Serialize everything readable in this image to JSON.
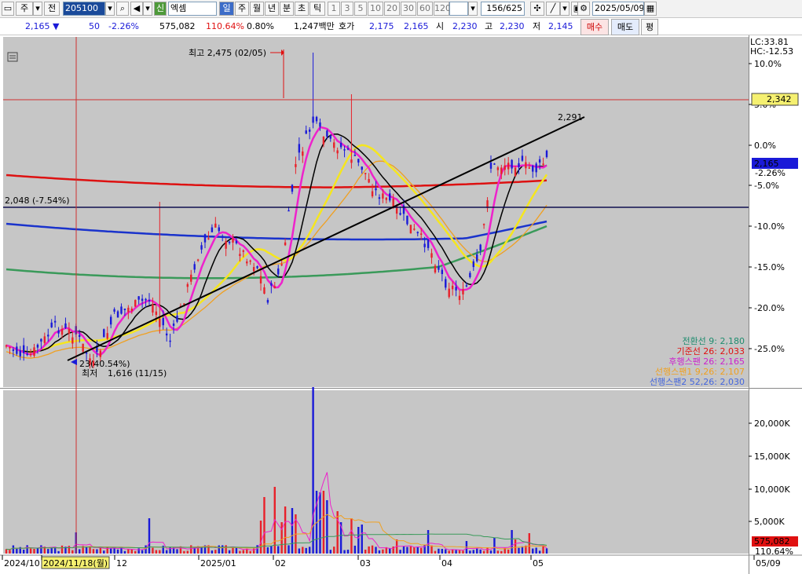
{
  "toolbar": {
    "mode_day": "주",
    "prev_label": "전",
    "code": "205100",
    "badge": "신",
    "stock_name": "엑셈",
    "periods": [
      "일",
      "주",
      "월",
      "년",
      "분",
      "초",
      "틱"
    ],
    "intervals": [
      "1",
      "3",
      "5",
      "10",
      "20",
      "30",
      "60",
      "120"
    ],
    "count": "156/625",
    "date": "2025/05/09"
  },
  "quote": {
    "price": "2,165",
    "arrow": "▼",
    "change": "50",
    "change_pct": "-2.26%",
    "volume": "575,082",
    "vol_ratio": "110.64%",
    "turnover": "0.80%",
    "amount": "1,247백만",
    "bid_label": "호가",
    "ask": "2,175",
    "bid": "2,165",
    "open_label": "시",
    "open": "2,230",
    "high_label": "고",
    "high": "2,230",
    "low_label": "저",
    "low": "2,145",
    "buy_button": "매수",
    "sell_button": "매도",
    "eval_button": "평"
  },
  "chart_data": {
    "type": "candlestick",
    "price_axis_ticks": [
      "10.0%",
      "5.0%",
      "0.0%",
      "-5.0%",
      "-10.0%",
      "-15.0%",
      "-20.0%",
      "-25.0%"
    ],
    "volume_axis_ticks": [
      "20,000K",
      "15,000K",
      "10,000K",
      "5,000K"
    ],
    "x_ticks": [
      "2024/10",
      "2024/11/18(월)",
      "12",
      "2025/01",
      "02",
      "03",
      "04",
      "05",
      "05/09"
    ],
    "lc": "LC:33.81",
    "hc": "HC:-12.53",
    "last_price_tag": "2,165",
    "last_price_pct": "-2.26%",
    "hline_tag": "2,342",
    "hline2_label": "2,048 (-7.54%)",
    "high_annot": "최고 2,475 (02/05)",
    "low_annot": "1,616 (11/15)",
    "low_annot_prefix": "최저",
    "low_annot_pct": "23(40.54%)",
    "trend_end_label": "2,291",
    "volume_tag": "575,082",
    "volume_pct": "110.64%",
    "ichimoku_legend": [
      {
        "name": "전환선 9: 2,180",
        "color": "#1e8c6e"
      },
      {
        "name": "기준선 26: 2,033",
        "color": "#e01010"
      },
      {
        "name": "후행스팬 26: 2,165",
        "color": "#cc22cc"
      },
      {
        "name": "선행스팬1 9,26: 2,107",
        "color": "#f0a020"
      },
      {
        "name": "선행스팬2 52,26: 2,030",
        "color": "#4466dd"
      }
    ],
    "colors": {
      "up": "#e8212a",
      "down": "#1a1ad8",
      "ma5": "#ee22cc",
      "ma10": "#000000",
      "ma20": "#f5e61e",
      "ma60": "#3a9a5a",
      "ma120": "#1a33cc",
      "ma240": "#dd1111",
      "cloud": "#f0a020"
    }
  }
}
